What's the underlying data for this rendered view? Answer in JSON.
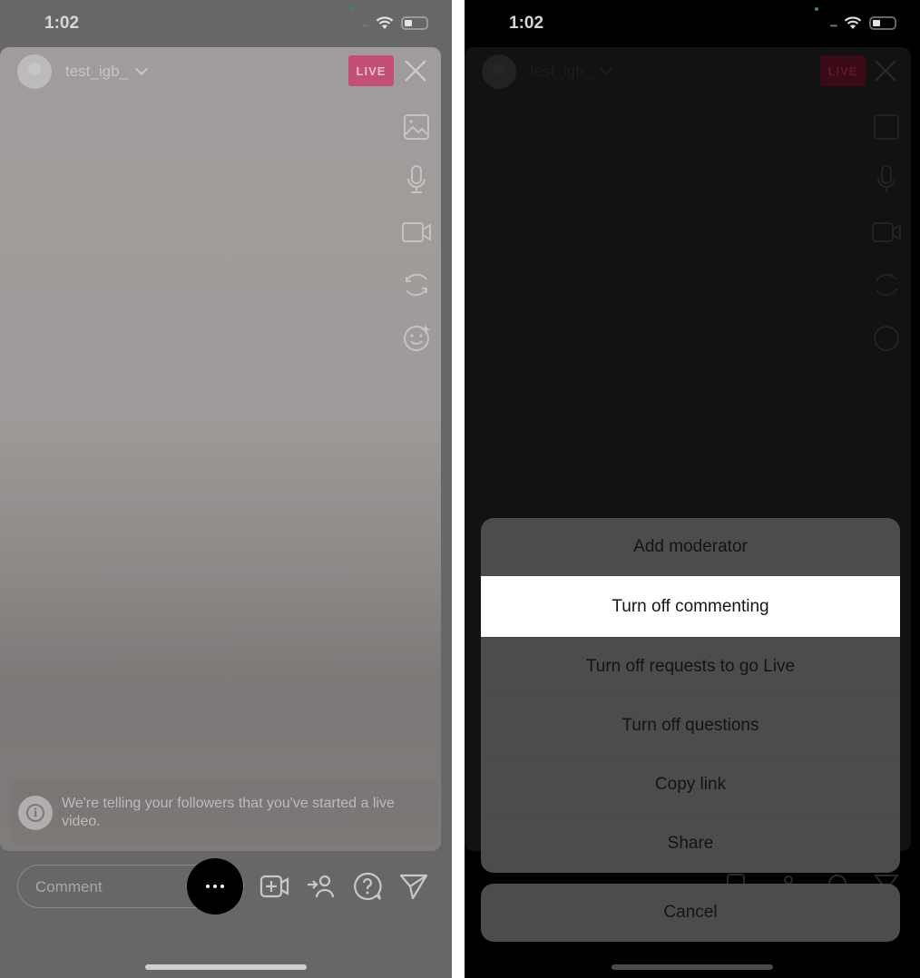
{
  "status_bar": {
    "time": "1:02"
  },
  "header": {
    "username": "test_igb_",
    "live_badge": "LIVE"
  },
  "side_toolbar": {
    "icons": [
      "image-icon",
      "microphone-icon",
      "video-camera-icon",
      "flip-camera-icon",
      "effects-icon"
    ]
  },
  "notice": {
    "text": "We're telling your followers that you've started a live video."
  },
  "bottom_bar": {
    "comment_placeholder": "Comment",
    "more_label": "More options",
    "icons": [
      "add-guest-video-icon",
      "invite-user-icon",
      "questions-icon",
      "share-send-icon"
    ]
  },
  "action_sheet": {
    "options": [
      {
        "label": "Add moderator",
        "highlighted": false
      },
      {
        "label": "Turn off commenting",
        "highlighted": true
      },
      {
        "label": "Turn off requests to go Live",
        "highlighted": false
      },
      {
        "label": "Turn off questions",
        "highlighted": false
      },
      {
        "label": "Copy link",
        "highlighted": false
      },
      {
        "label": "Share",
        "highlighted": false
      }
    ],
    "cancel_label": "Cancel"
  },
  "colors": {
    "live_badge": "#c34f77",
    "highlight": "#ffffff",
    "sheet_bg": "#4c4c4c",
    "overlay_dim": "#676767"
  }
}
